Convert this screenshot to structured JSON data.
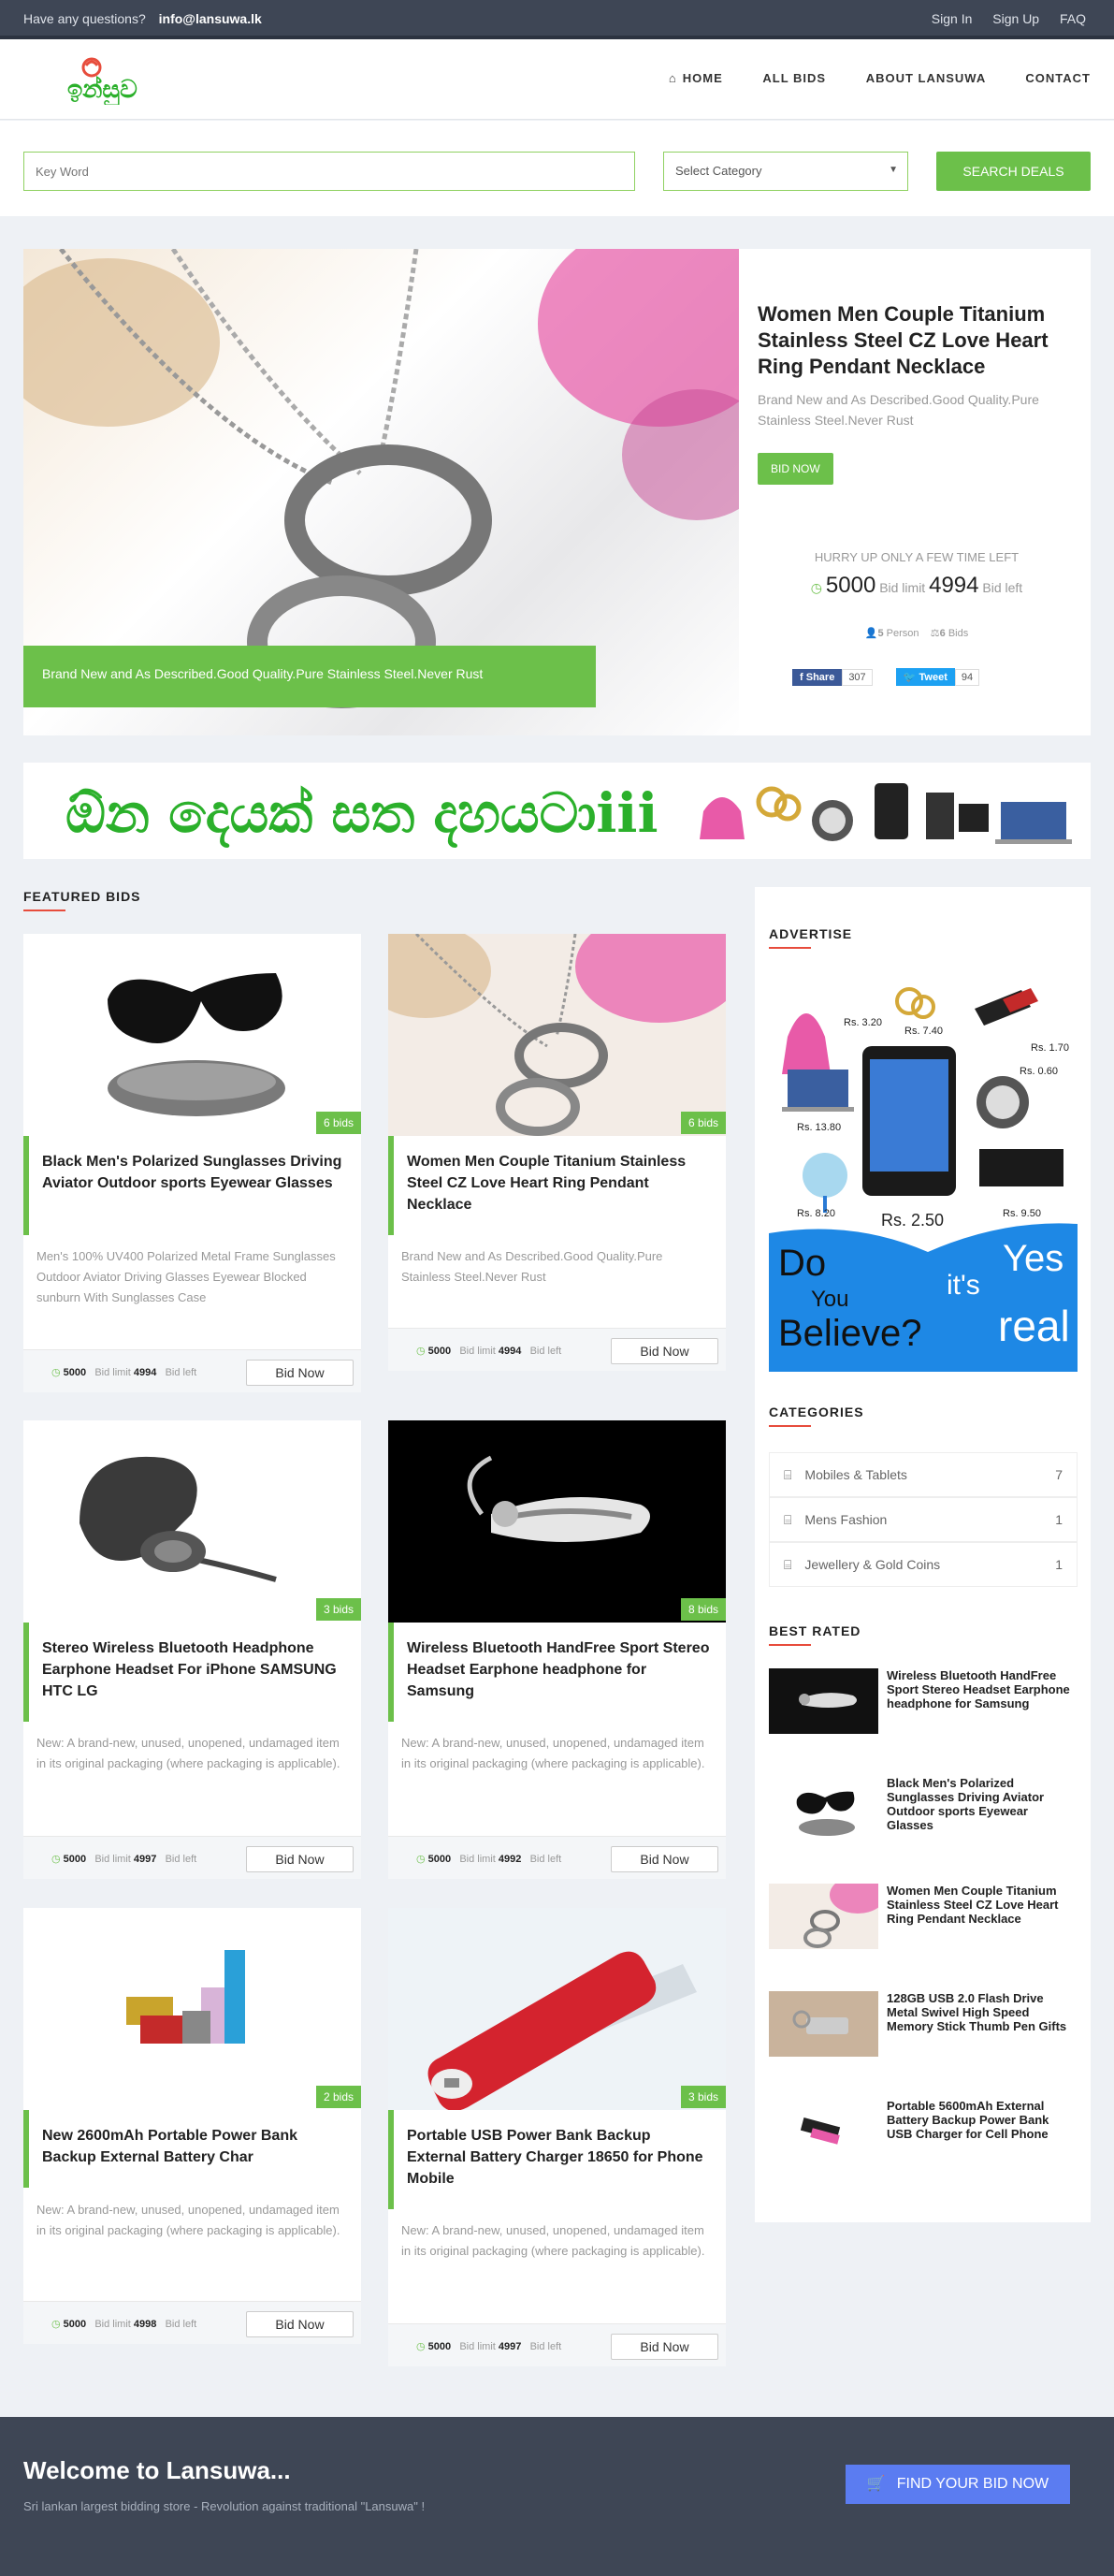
{
  "topbar": {
    "question": "Have any questions?",
    "email": "info@lansuwa.lk",
    "signin": "Sign In",
    "signup": "Sign Up",
    "faq": "FAQ"
  },
  "nav": {
    "home": "HOME",
    "all_bids": "ALL BIDS",
    "about": "ABOUT LANSUWA",
    "contact": "CONTACT"
  },
  "search": {
    "keyword_placeholder": "Key Word",
    "category": "Select Category",
    "button": "SEARCH DEALS"
  },
  "hero": {
    "caption": "Brand New and As Described.Good Quality.Pure Stainless Steel.Never Rust",
    "title": "Women Men Couple Titanium Stainless Steel CZ Love Heart Ring Pendant Necklace",
    "desc": "Brand New and As Described.Good Quality.Pure Stainless Steel.Never Rust",
    "bid_now": "BID NOW",
    "hurry": "HURRY UP ONLY A FEW TIME LEFT",
    "start": "5000",
    "limit_label": "Bid limit",
    "limit": "4994",
    "left_label": "Bid left",
    "persons": "5",
    "persons_label": "Person",
    "bids": "6",
    "bids_label": "Bids",
    "fb_share": "Share",
    "fb_count": "307",
    "tweet": "Tweet",
    "tw_count": "94"
  },
  "banner": {
    "text": "ඕන දෙයක් සත දහයටාiii"
  },
  "featured": {
    "title": "FEATURED BIDS",
    "cards": [
      {
        "bids": "6 bids",
        "title": "Black Men's Polarized Sunglasses Driving Aviator Outdoor sports Eyewear Glasses",
        "desc": "Men's 100% UV400 Polarized Metal Frame Sunglasses Outdoor Aviator Driving Glasses Eyewear Blocked sunburn With Sunglasses Case",
        "start": "5000",
        "limit_label": "Bid limit",
        "limit": "4994",
        "left_label": "Bid left",
        "button": "Bid Now"
      },
      {
        "bids": "6 bids",
        "title": "Women Men Couple Titanium Stainless Steel CZ Love Heart Ring Pendant Necklace",
        "desc": "Brand New and As Described.Good Quality.Pure Stainless Steel.Never Rust",
        "start": "5000",
        "limit_label": "Bid limit",
        "limit": "4994",
        "left_label": "Bid left",
        "button": "Bid Now"
      },
      {
        "bids": "3 bids",
        "title": "Stereo Wireless Bluetooth Headphone Earphone Headset For iPhone SAMSUNG HTC LG",
        "desc": "New: A brand-new, unused, unopened, undamaged item in its original packaging (where packaging is applicable).",
        "start": "5000",
        "limit_label": "Bid limit",
        "limit": "4997",
        "left_label": "Bid left",
        "button": "Bid Now"
      },
      {
        "bids": "8 bids",
        "title": "Wireless Bluetooth HandFree Sport Stereo Headset Earphone headphone for Samsung",
        "desc": "New: A brand-new, unused, unopened, undamaged item in its original packaging (where packaging is applicable).",
        "start": "5000",
        "limit_label": "Bid limit",
        "limit": "4992",
        "left_label": "Bid left",
        "button": "Bid Now"
      },
      {
        "bids": "2 bids",
        "title": "New 2600mAh Portable Power Bank Backup External Battery Char",
        "desc": "New: A brand-new, unused, unopened, undamaged item in its original packaging (where packaging is applicable).",
        "start": "5000",
        "limit_label": "Bid limit",
        "limit": "4998",
        "left_label": "Bid left",
        "button": "Bid Now"
      },
      {
        "bids": "3 bids",
        "title": "Portable USB Power Bank Backup External Battery Charger 18650 for Phone Mobile",
        "desc": "New: A brand-new, unused, unopened, undamaged item in its original packaging (where packaging is applicable).",
        "start": "5000",
        "limit_label": "Bid limit",
        "limit": "4997",
        "left_label": "Bid left",
        "button": "Bid Now"
      }
    ]
  },
  "sidebar": {
    "advertise": "ADVERTISE",
    "ad": {
      "p1": "Rs. 3.20",
      "p2": "Rs. 7.40",
      "p3": "Rs. 1.70",
      "p4": "Rs. 0.60",
      "p5": "Rs. 13.80",
      "p6": "Rs. 8.20",
      "p7": "Rs. 2.50",
      "p8": "Rs. 9.50",
      "do": "Do",
      "you": "You",
      "believe": "Believe?",
      "its": "it's",
      "yes": "Yes",
      "real": "real"
    },
    "categories_title": "CATEGORIES",
    "categories": [
      {
        "name": "Mobiles & Tablets",
        "count": "7"
      },
      {
        "name": "Mens Fashion",
        "count": "1"
      },
      {
        "name": "Jewellery & Gold Coins",
        "count": "1"
      }
    ],
    "best_rated_title": "BEST RATED",
    "best_rated": [
      {
        "title": "Wireless Bluetooth HandFree Sport Stereo Headset Earphone headphone for Samsung"
      },
      {
        "title": "Black Men's Polarized Sunglasses Driving Aviator Outdoor sports Eyewear Glasses"
      },
      {
        "title": "Women Men Couple Titanium Stainless Steel CZ Love Heart Ring Pendant Necklace"
      },
      {
        "title": "128GB USB 2.0 Flash Drive Metal Swivel High Speed Memory Stick Thumb Pen Gifts"
      },
      {
        "title": "Portable 5600mAh External Battery Backup Power Bank USB Charger for Cell Phone"
      }
    ]
  },
  "footer": {
    "title": "Welcome to Lansuwa...",
    "subtitle": "Sri lankan largest bidding store - Revolution against traditional \"Lansuwa\" !",
    "button": "FIND YOUR BID NOW"
  },
  "colors": {
    "accent": "#6cc04a",
    "dark": "#3e4655",
    "footer_button": "#5b7cf1"
  }
}
